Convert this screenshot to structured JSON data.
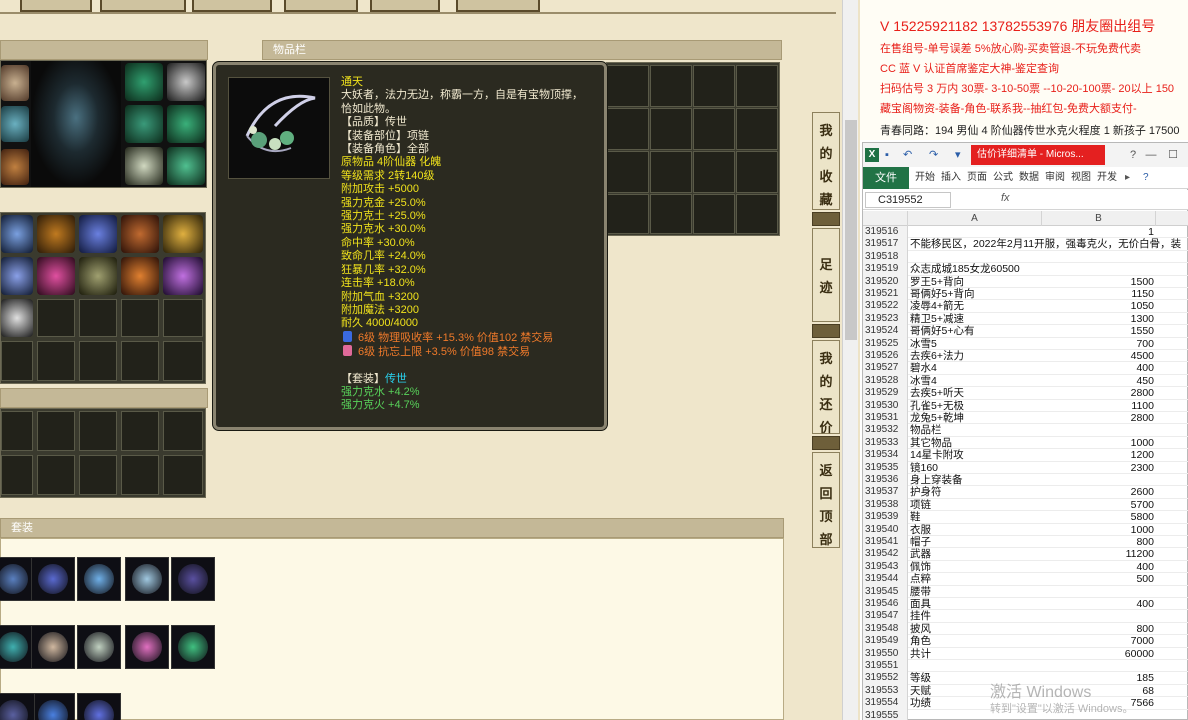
{
  "game": {
    "inventory_title": "物品栏",
    "suit_section_title": "套装"
  },
  "tooltip": {
    "name": "通天",
    "description_1": "大妖者，法力无边，称霸一方，自是有宝物顶撑，",
    "description_2": "恰如此物。",
    "quality": "【品质】传世",
    "slot": "【装备部位】项链",
    "role": "【装备角色】全部",
    "origin": "原物品 4阶仙器 化魄",
    "level_req": "等级需求 2转140级",
    "stats": [
      "附加攻击 +5000",
      "强力克金 +25.0%",
      "强力克土 +25.0%",
      "强力克水 +30.0%",
      "命中率 +30.0%",
      "致命几率 +24.0%",
      "狂暴几率 +32.0%",
      "连击率 +18.0%",
      "附加气血 +3200",
      "附加魔法 +3200"
    ],
    "durability": "耐久 4000/4000",
    "gem_lines": [
      "6级 物理吸收率 +15.3% 价值102 禁交易",
      "6级 抗忘上限 +3.5% 价值98 禁交易"
    ],
    "set_label": "【套装】",
    "set_name": "传世",
    "set_stats": [
      "强力克水 +4.2%",
      "强力克火 +4.7%"
    ]
  },
  "side_nav": [
    {
      "label": "我的收藏"
    },
    {
      "label": "足迹"
    },
    {
      "label": "我的还价"
    },
    {
      "label": "返回顶部"
    }
  ],
  "ad": {
    "line1": "V 15225921182   13782553976 朋友圈出组号",
    "line2": "在售组号-单号误差 5%放心购-买卖管退-不玩免费代卖",
    "line3": "CC 蓝 V 认证首席鉴定大神-鉴定查询",
    "line4": "扫码估号 3 万内 30票- 3-10-50票 --10-20-100票- 20以上 150",
    "line5": "藏宝阁物资-装备-角色-联系我--抽红包-免费大额支付-",
    "line6": "青春同路：194 男仙 4 阶仙器传世水克火程度 1 新孩子 17500"
  },
  "excel": {
    "doc_title": "估价详细清单 - Micros...",
    "file_tab": "文件",
    "ribbon_tabs": [
      "开始",
      "插入",
      "页面",
      "公式",
      "数据",
      "审阅",
      "视图",
      "开发"
    ],
    "name_box": "C319552",
    "fx": "fx",
    "columns": [
      "A",
      "B"
    ],
    "rows": [
      {
        "n": "319516",
        "a": "",
        "b": "1"
      },
      {
        "n": "319517",
        "a": "不能移民区，2022年2月11开服，强毒克火，无价白骨，装",
        "b": ""
      },
      {
        "n": "319518",
        "a": "",
        "b": ""
      },
      {
        "n": "319519",
        "a": "众志成城185女龙60500",
        "b": ""
      },
      {
        "n": "319520",
        "a": "罗王5+背向",
        "b": "1500"
      },
      {
        "n": "319521",
        "a": "哥俩好5+背向",
        "b": "1150"
      },
      {
        "n": "319522",
        "a": "凌辱4+箭无",
        "b": "1050"
      },
      {
        "n": "319523",
        "a": "精卫5+减速",
        "b": "1300"
      },
      {
        "n": "319524",
        "a": "哥俩好5+心有",
        "b": "1550"
      },
      {
        "n": "319525",
        "a": "冰雪5",
        "b": "700"
      },
      {
        "n": "319526",
        "a": "去疾6+法力",
        "b": "4500"
      },
      {
        "n": "319527",
        "a": "碧水4",
        "b": "400"
      },
      {
        "n": "319528",
        "a": "冰雪4",
        "b": "450"
      },
      {
        "n": "319529",
        "a": "去疾5+听天",
        "b": "2800"
      },
      {
        "n": "319530",
        "a": "孔雀5+无极",
        "b": "1100"
      },
      {
        "n": "319531",
        "a": "龙兔5+乾坤",
        "b": "2800"
      },
      {
        "n": "319532",
        "a": "物品栏",
        "b": ""
      },
      {
        "n": "319533",
        "a": "其它物品",
        "b": "1000"
      },
      {
        "n": "319534",
        "a": "14星卡附攻",
        "b": "1200"
      },
      {
        "n": "319535",
        "a": "镜160",
        "b": "2300"
      },
      {
        "n": "319536",
        "a": "身上穿装备",
        "b": ""
      },
      {
        "n": "319537",
        "a": "护身符",
        "b": "2600"
      },
      {
        "n": "319538",
        "a": "项链",
        "b": "5700"
      },
      {
        "n": "319539",
        "a": "鞋",
        "b": "5800"
      },
      {
        "n": "319540",
        "a": "衣服",
        "b": "1000"
      },
      {
        "n": "319541",
        "a": "帽子",
        "b": "800"
      },
      {
        "n": "319542",
        "a": "武器",
        "b": "11200"
      },
      {
        "n": "319543",
        "a": "佩饰",
        "b": "400"
      },
      {
        "n": "319544",
        "a": "点粹",
        "b": "500"
      },
      {
        "n": "319545",
        "a": "腰带",
        "b": ""
      },
      {
        "n": "319546",
        "a": "面具",
        "b": "400"
      },
      {
        "n": "319547",
        "a": "挂件",
        "b": ""
      },
      {
        "n": "319548",
        "a": "披风",
        "b": "800"
      },
      {
        "n": "319549",
        "a": "角色",
        "b": "7000"
      },
      {
        "n": "319550",
        "a": "共计",
        "b": "60000"
      },
      {
        "n": "319551",
        "a": "",
        "b": ""
      },
      {
        "n": "319552",
        "a": "等级",
        "b": "185"
      },
      {
        "n": "319553",
        "a": "天赋",
        "b": "68"
      },
      {
        "n": "319554",
        "a": "功绩",
        "b": "7566"
      },
      {
        "n": "319555",
        "a": "",
        "b": ""
      }
    ]
  },
  "watermark": {
    "line1": "激活 Windows",
    "line2": "转到\"设置\"以激活 Windows。"
  }
}
